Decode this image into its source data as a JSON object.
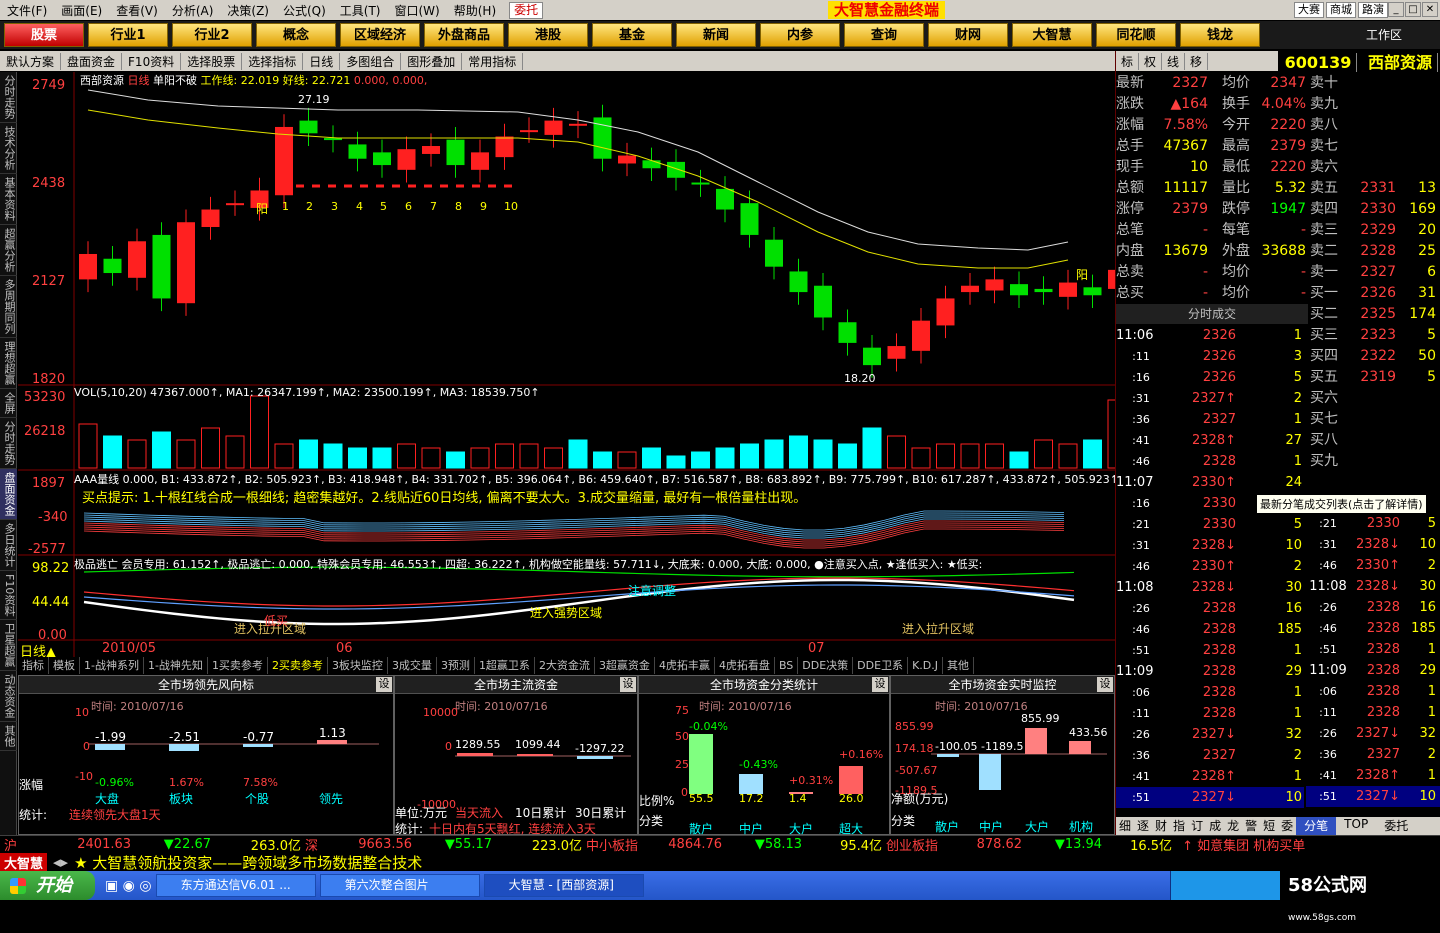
{
  "menu": {
    "items": [
      "文件(F)",
      "画面(E)",
      "查看(V)",
      "分析(A)",
      "决策(Z)",
      "公式(Q)",
      "工具(T)",
      "窗口(W)",
      "帮助(H)"
    ],
    "tag": "委托",
    "title": "大智慧金融终端",
    "right": [
      "大赛",
      "商城",
      "路演"
    ]
  },
  "nav": {
    "buttons": [
      "股票",
      "行业1",
      "行业2",
      "概念",
      "区域经济",
      "外盘商品",
      "港股",
      "基金",
      "新闻",
      "内参",
      "查询",
      "财网",
      "大智慧",
      "同花顺",
      "钱龙"
    ],
    "workspace": "工作区"
  },
  "toolbar": {
    "items": [
      "默认方案",
      "盘面资金",
      "F10资料",
      "选择股票",
      "选择指标",
      "日线",
      "多图组合",
      "图形叠加",
      "常用指标"
    ]
  },
  "lefttabs": [
    "分时走势",
    "技术分析",
    "基本资料",
    "超赢分析",
    "多周期同列",
    "理想超赢",
    "全屏",
    "分时走势",
    "盘面资金",
    "多日统计",
    "F10资料",
    "卫星超赢",
    "动态资金",
    "其他"
  ],
  "chart": {
    "main_label": {
      "name": "西部资源",
      "period": "日线",
      "extra": "单阳不破",
      "l1": "工作线: 22.019",
      "l2": "好线: 22.721",
      "l3": "0.000, 0.000,"
    },
    "price_ticks": [
      "2749",
      "2438",
      "2127",
      "1820"
    ],
    "high_label": "27.19",
    "low_label": "18.20",
    "yang_label": "阳",
    "yang_label2": "阳",
    "counts": [
      "1",
      "2",
      "3",
      "4",
      "5",
      "6",
      "7",
      "8",
      "9",
      "10"
    ],
    "vol_label": "VOL(5,10,20) 47367.000↑, MA1: 26347.199↑, MA2: 23500.199↑, MA3: 18539.750↑",
    "vol_ticks": [
      "53230",
      "26218"
    ],
    "aaa_label": "AAA量线 0.000, B1: 433.872↑, B2: 505.923↑, B3: 418.948↑, B4: 331.702↑, B5: 396.064↑, B6: 459.640↑, B7: 516.587↑, B8: 683.892↑, B9: 775.799↑, B10: 617.287↑, 433.872↑, 505.923↑",
    "aaa_ticks": [
      "1897",
      "-340",
      "-2577"
    ],
    "hint": "买点提示: 1.十根红线合成一根细线; 趋密集越好。2.线贴近60日均线, 偏离不要太大。3.成交量缩量, 最好有一根倍量柱出现。",
    "jp_label": "极品逃亡  会员专用: 61.152↑, 极品逃亡: 0.000, 特殊会员专用: 46.553↑, 四超: 36.222↑, 机构做空能量线: 57.711↓, 大底来: 0.000, 大底: 0.000, ●注意买入点, ★逢低买入: ★低买:",
    "jp_ticks": [
      "98.22",
      "44.44",
      "0.00"
    ],
    "jp_texts": [
      "注意调整",
      "进入强势区域",
      "进入拉升区域",
      "进入拉升区域",
      "低买"
    ],
    "date_labels": [
      "2010/05",
      "06",
      "07"
    ],
    "period": "日线"
  },
  "bottomtabs": [
    "指标",
    "模板",
    "1-战神系列",
    "1-战神先知",
    "1买卖参考",
    "2买卖参考",
    "3板块监控",
    "3成交量",
    "3预测",
    "1超赢卫系",
    "2大资金流",
    "3超赢资金",
    "4虎拓丰赢",
    "4虎拓看盘",
    "BS",
    "DDE决策",
    "DDE卫系",
    "K.D.J",
    "其他"
  ],
  "panels": [
    {
      "title": "全市场领先风向标",
      "date": "时间: 2010/07/16",
      "y": [
        "10",
        "0",
        "-10"
      ],
      "vals": [
        "-1.99",
        "-2.51",
        "-0.77",
        "1.13"
      ],
      "pcts": [
        "-0.96%",
        "1.67%",
        "7.58%"
      ],
      "cats": [
        "大盘",
        "板块",
        "个股",
        "领先"
      ],
      "ylab": "涨幅",
      "foot": "统计:",
      "foot2": "连续领先大盘1天"
    },
    {
      "title": "全市场主流资金",
      "date": "时间: 2010/07/16",
      "y": [
        "10000",
        "0",
        "-10000"
      ],
      "vals": [
        "1289.55",
        "1099.44",
        "-1297.22"
      ],
      "foot": "单位:万元",
      "foot2": "当天流入",
      "foot3": "10日累计",
      "foot4": "30日累计",
      "stat": "统计:",
      "stat2": "十日内有5天飘红, 连续流入3天"
    },
    {
      "title": "全市场资金分类统计",
      "date": "时间: 2010/07/16",
      "y": [
        "75",
        "50",
        "25",
        "0"
      ],
      "vals": [
        "-0.04%",
        "-0.43%",
        "+0.31%",
        "+0.16%"
      ],
      "ratio": [
        "55.5",
        "17.2",
        "1.4",
        "26.0"
      ],
      "cats": [
        "散户",
        "中户",
        "大户",
        "超大"
      ],
      "ylab": "比例%",
      "foot": "分类"
    },
    {
      "title": "全市场资金实时监控",
      "date": "时间: 2010/07/16",
      "y": [
        "855.99",
        "174.18",
        "-507.67",
        "-1189.5"
      ],
      "vals": [
        "-100.05",
        "-1189.5",
        "855.99",
        "433.56"
      ],
      "cats": [
        "散户",
        "中户",
        "大户",
        "机构"
      ],
      "ylab": "净额(万元)",
      "foot": "分类"
    }
  ],
  "quote": {
    "code": "600139",
    "name": "西部资源",
    "top": [
      "标",
      "权",
      "线",
      "移"
    ],
    "rows": [
      [
        "最新",
        "2327",
        "均价",
        "2347"
      ],
      [
        "涨跌",
        "▲164",
        "换手",
        "4.04%"
      ],
      [
        "涨幅",
        "7.58%",
        "今开",
        "2220"
      ],
      [
        "总手",
        "47367",
        "最高",
        "2379"
      ],
      [
        "现手",
        "10",
        "最低",
        "2220"
      ],
      [
        "总额",
        "11117",
        "量比",
        "5.32"
      ],
      [
        "涨停",
        "2379",
        "跌停",
        "1947"
      ],
      [
        "总笔",
        "-",
        "每笔",
        "-"
      ],
      [
        "内盘",
        "13679",
        "外盘",
        "33688"
      ],
      [
        "总卖",
        "-",
        "均价",
        "-"
      ],
      [
        "总买",
        "-",
        "均价",
        "-"
      ]
    ],
    "book": [
      [
        "卖十",
        "",
        ""
      ],
      [
        "卖九",
        "",
        ""
      ],
      [
        "卖八",
        "",
        ""
      ],
      [
        "卖七",
        "",
        ""
      ],
      [
        "卖六",
        "",
        ""
      ],
      [
        "卖五",
        "2331",
        "13"
      ],
      [
        "卖四",
        "2330",
        "169"
      ],
      [
        "卖三",
        "2329",
        "20"
      ],
      [
        "卖二",
        "2328",
        "25"
      ],
      [
        "卖一",
        "2327",
        "6"
      ],
      [
        "买一",
        "2326",
        "31"
      ],
      [
        "买二",
        "2325",
        "174"
      ],
      [
        "买三",
        "2323",
        "5"
      ],
      [
        "买四",
        "2322",
        "50"
      ],
      [
        "买五",
        "2319",
        "5"
      ],
      [
        "买六",
        "",
        ""
      ],
      [
        "买七",
        "",
        ""
      ],
      [
        "买八",
        "",
        ""
      ],
      [
        "买九",
        "",
        ""
      ],
      [
        "买十",
        "",
        ""
      ]
    ],
    "tick_title": "分时成交",
    "ticks": [
      [
        "11:06",
        "2326",
        "1"
      ],
      [
        ":11",
        "2326",
        "3"
      ],
      [
        ":16",
        "2326",
        "5"
      ],
      [
        ":31",
        "2327↑",
        "2"
      ],
      [
        ":36",
        "2327",
        "1"
      ],
      [
        ":41",
        "2328↑",
        "27"
      ],
      [
        ":46",
        "2328",
        "1"
      ],
      [
        "11:07",
        "2330↑",
        "24"
      ],
      [
        ":16",
        "2330",
        ""
      ],
      [
        ":21",
        "2330",
        "5"
      ],
      [
        ":31",
        "2328↓",
        "10"
      ],
      [
        ":46",
        "2330↑",
        "2"
      ],
      [
        "11:08",
        "2328↓",
        "30"
      ],
      [
        ":26",
        "2328",
        "16"
      ],
      [
        ":46",
        "2328",
        "185"
      ],
      [
        ":51",
        "2328",
        "1"
      ],
      [
        "11:09",
        "2328",
        "29"
      ],
      [
        ":06",
        "2328",
        "1"
      ],
      [
        ":11",
        "2328",
        "1"
      ],
      [
        ":26",
        "2327↓",
        "32"
      ],
      [
        ":36",
        "2327",
        "2"
      ],
      [
        ":41",
        "2328↑",
        "1"
      ],
      [
        ":51",
        "2327↓",
        "10"
      ]
    ],
    "tooltip": "最新分笔成交列表(点击了解详情)",
    "tabs": [
      "细",
      "逐",
      "财",
      "指",
      "订",
      "成",
      "龙",
      "警",
      "短",
      "委"
    ],
    "tabs2": [
      "分笔",
      "TOP",
      "委托"
    ]
  },
  "status": {
    "sh_label": "沪",
    "sh": "2401.63",
    "sh_ch": "▼22.67",
    "sh_amt": "263.0亿",
    "sz_label": "深",
    "sz": "9663.56",
    "sz_ch": "▼55.17",
    "sz_amt": "223.0亿",
    "zx_label": "中小板指",
    "zx": "4864.76",
    "zx_ch": "▼58.13",
    "zx_amt": "95.4亿",
    "cy_label": "创业板指",
    "cy": "878.62",
    "cy_ch": "▼13.94",
    "cy_amt": "16.5亿",
    "news": "↑ 如意集团 机构买单"
  },
  "ticker": {
    "brand": "大智慧",
    "text": "★ 大智慧领航投资家——跨领域多市场数据整合技术"
  },
  "taskbar": {
    "start": "开始",
    "tasks": [
      "东方通达信V6.01 ...",
      "第六次整合图片",
      "大智慧 - [西部资源]"
    ],
    "site": "58公式网",
    "url": "www.58gs.com"
  },
  "colors": {
    "up": "#ff3030",
    "down": "#00e000",
    "bg": "#000000"
  }
}
